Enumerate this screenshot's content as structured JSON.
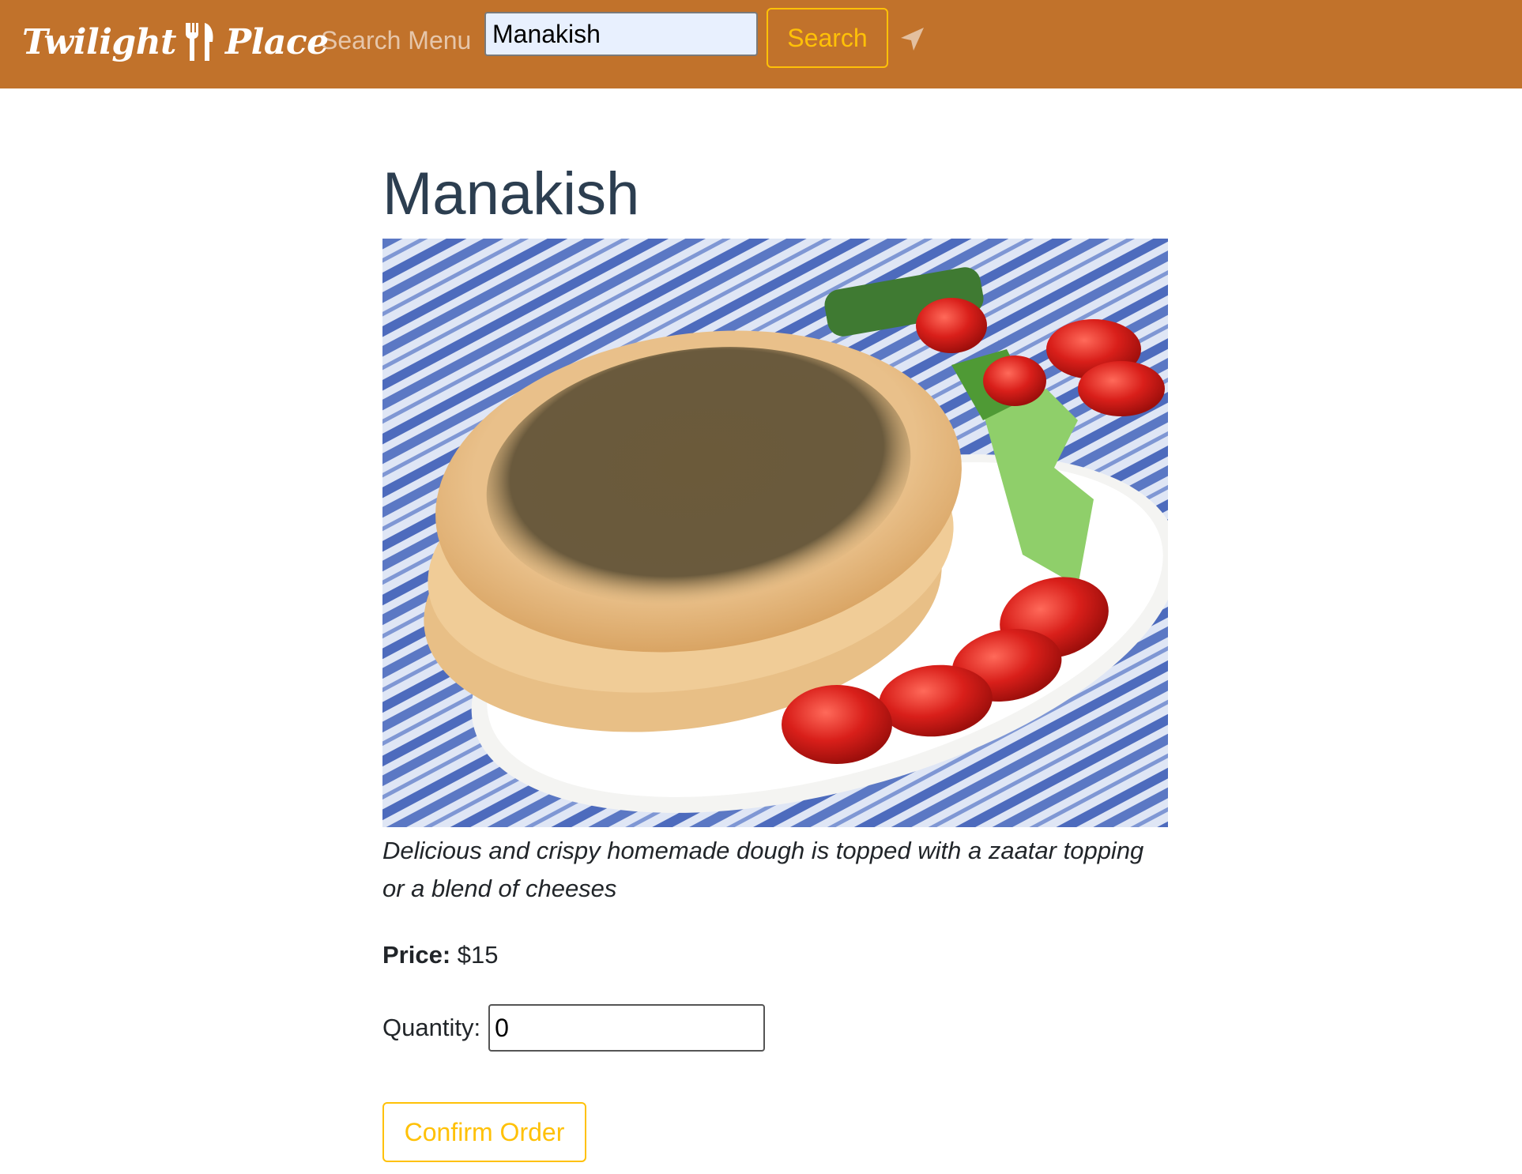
{
  "nav": {
    "brand_left": "Twilight",
    "brand_right": "Place",
    "brand_icon": "fork-knife-icon",
    "search_label": "Search Menu",
    "search_value": "Manakish",
    "search_button": "Search",
    "location_icon": "location-arrow-icon",
    "bg_color": "#c1722b",
    "accent_color": "#ffc107"
  },
  "item": {
    "title": "Manakish",
    "image_alt": "Manakish",
    "description": "Delicious and crispy homemade dough is topped with a zaatar topping or a blend of cheeses",
    "price_label": "Price:",
    "price_value": "$15",
    "quantity_label": "Quantity:",
    "quantity_value": "0",
    "confirm_button": "Confirm Order"
  }
}
